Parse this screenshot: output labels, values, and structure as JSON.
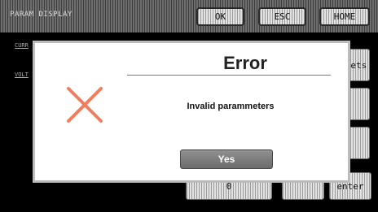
{
  "window": {
    "title": "PARAM DISPLAY"
  },
  "header": {
    "ok_label": "OK",
    "esc_label": "ESC",
    "home_label": "HOME"
  },
  "side": {
    "label1": "CURR",
    "label2": "VOLT"
  },
  "keys": {
    "sets_label": "sets",
    "zero_label": "0",
    "enter_label": "enter"
  },
  "dialog": {
    "title": "Error",
    "message": "Invalid parammeters",
    "yes_label": "Yes",
    "icon": "close-x-icon",
    "icon_color": "#f07d5e"
  }
}
